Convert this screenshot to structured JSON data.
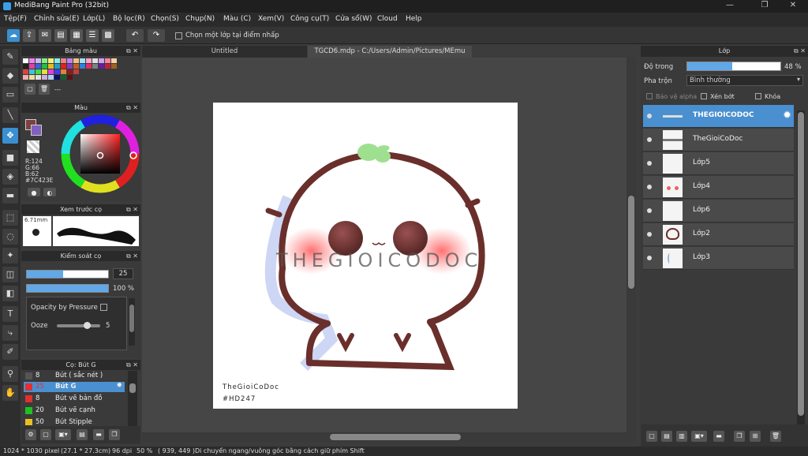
{
  "app": {
    "title": "MediBang Paint Pro (32bit)"
  },
  "window_controls": {
    "minimize": "—",
    "maximize": "❐",
    "close": "✕"
  },
  "menu": [
    "Tệp(F)",
    "Chỉnh sửa(E)",
    "Lớp(L)",
    "Bộ lọc(R)",
    "Chọn(S)",
    "Chụp(N)",
    "Màu (C)",
    "Xem(V)",
    "Công cụ(T)",
    "Cửa sổ(W)",
    "Cloud",
    "Help"
  ],
  "toolbar": {
    "checkbox_label": "Chọn một lớp tại điểm nhấp",
    "undo": "↶",
    "redo": "↷"
  },
  "tabs": {
    "tab1": "Untitled",
    "tab2": "TGCD6.mdp - C:/Users/Admin/Pictures/MEmu Photo"
  },
  "palette_panel": {
    "title": "Bảng màu",
    "dash": "---"
  },
  "color_panel": {
    "title": "Màu",
    "r": "R:124",
    "g": "G:66",
    "b": "B:62",
    "hex": "#7C423E",
    "color": "#7C423E"
  },
  "preview_panel": {
    "title": "Xem trước cọ",
    "size": "6.71mm"
  },
  "brush_control": {
    "title": "Kiểm soát cọ",
    "size_value": "25",
    "opacity_value": "100 %",
    "size_fraction": 0.45,
    "opacity_fraction": 1.0,
    "opacity_pressure_label": "Opacity by Pressure",
    "ooze_label": "Ooze",
    "ooze_value": "5",
    "ooze_fraction": 0.7
  },
  "brush_list": {
    "title": "Cọ: Bút G",
    "items": [
      {
        "size": "8",
        "name": "Bút ( sắc nét )",
        "color": "#555555"
      },
      {
        "size": "25",
        "name": "Bút G",
        "color": "#e03030"
      },
      {
        "size": "8",
        "name": "Bút vẽ bản đồ",
        "color": "#e03030"
      },
      {
        "size": "20",
        "name": "Bút vẽ cạnh",
        "color": "#20c020"
      },
      {
        "size": "50",
        "name": "Bút Stipple",
        "color": "#e8c020"
      }
    ]
  },
  "layer_panel": {
    "title": "Lớp",
    "opacity_label": "Độ trong",
    "opacity_value": "48 %",
    "opacity_fraction": 0.48,
    "blend_label": "Pha trộn",
    "blend_value": "Bình thường",
    "protect_alpha": "Bảo vệ alpha",
    "clip": "Xén bớt",
    "lock": "Khóa",
    "layers": [
      "THEGIOICODOC",
      "TheGioiCoDoc",
      "Lớp5",
      "Lớp4",
      "Lớp6",
      "Lớp2",
      "Lớp3"
    ]
  },
  "canvas": {
    "watermark": "THEGIOICODOC",
    "signature_line1": "TheGioiCoDoc",
    "signature_line2": "#HD247"
  },
  "status": {
    "size": "1024 * 1030 pixel",
    "cm": "(27.1 * 27.3cm)",
    "dpi": "96 dpi",
    "zoom": "50 %",
    "coords": "( 939, 449 )",
    "hint": "Di chuyển ngang/vuông góc bằng cách giữ phím Shift"
  }
}
